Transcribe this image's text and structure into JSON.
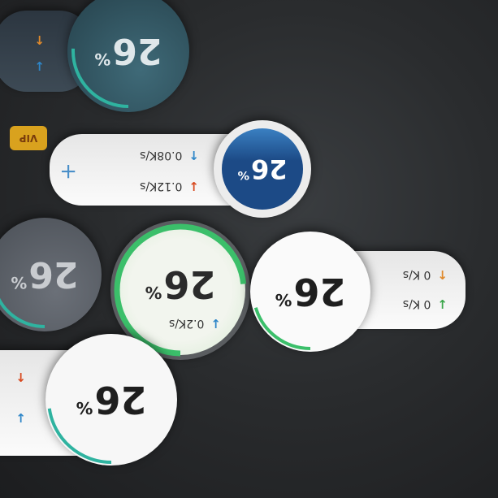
{
  "widgets": [
    {
      "id": "w1",
      "percent": "26",
      "unit": "%",
      "up": "",
      "down": ""
    },
    {
      "id": "w2",
      "percent": "26",
      "unit": "%",
      "up": "0.08K/s",
      "down": "0.12K/s"
    },
    {
      "id": "w3",
      "percent": "26",
      "unit": "%",
      "up": "",
      "down": ""
    },
    {
      "id": "w4",
      "percent": "26",
      "unit": "%",
      "up": "",
      "down": "0.2K/s"
    },
    {
      "id": "w5",
      "percent": "26",
      "unit": "%",
      "up": "0 K/s",
      "down": "0 K/s"
    },
    {
      "id": "w6",
      "percent": "26",
      "unit": "%",
      "up": "",
      "down": ""
    }
  ],
  "vip": {
    "label": "VIP"
  },
  "icons": {
    "up": "arrow-up-icon",
    "down": "arrow-down-icon",
    "add": "plus-icon",
    "vip": "vip-crown-icon"
  },
  "colors": {
    "up_orange": "#e08a2c",
    "down_blue": "#2e86c8",
    "down_green": "#3aa64a",
    "ring_green": "#3bbf6a",
    "ring_teal": "#2fb3a0",
    "dark_blue": "#1f4f8a"
  }
}
